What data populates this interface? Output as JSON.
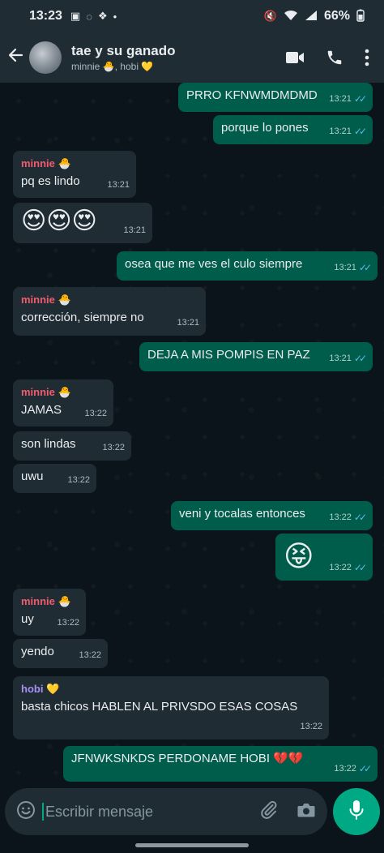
{
  "status_bar": {
    "time": "13:23",
    "battery": "66%"
  },
  "header": {
    "title": "tae y su ganado",
    "subtitle": "minnie 🐣, hobi 💛"
  },
  "messages": [
    {
      "dir": "out",
      "text": "PRRO KFNWMDMDMD",
      "time": "13:21"
    },
    {
      "dir": "out",
      "text": "porque lo pones",
      "time": "13:21"
    },
    {
      "dir": "in",
      "sender": "minnie 🐣",
      "text": "pq es lindo",
      "time": "13:21"
    },
    {
      "dir": "in",
      "text": "😍😍😍",
      "time": "13:21"
    },
    {
      "dir": "out",
      "text": "osea que me ves el culo siempre",
      "time": "13:21"
    },
    {
      "dir": "in",
      "sender": "minnie 🐣",
      "text": "corrección, siempre no",
      "time": "13:21"
    },
    {
      "dir": "out",
      "text": "DEJA A MIS POMPIS EN PAZ",
      "time": "13:21"
    },
    {
      "dir": "in",
      "sender": "minnie 🐣",
      "text": "JAMAS",
      "time": "13:22"
    },
    {
      "dir": "in",
      "text": "son lindas",
      "time": "13:22"
    },
    {
      "dir": "in",
      "text": "uwu",
      "time": "13:22"
    },
    {
      "dir": "out",
      "text": "veni y tocalas entonces",
      "time": "13:22"
    },
    {
      "dir": "out",
      "text": "😝",
      "time": "13:22"
    },
    {
      "dir": "in",
      "sender": "minnie 🐣",
      "text": "uy",
      "time": "13:22"
    },
    {
      "dir": "in",
      "text": "yendo",
      "time": "13:22"
    },
    {
      "dir": "in",
      "sender": "hobi 💛",
      "text": "basta chicos HABLEN AL PRIVSDO ESAS COSAS",
      "time": "13:22"
    },
    {
      "dir": "out",
      "text": "JFNWKSNKDS PERDONAME HOBI 💔💔",
      "time": "13:22"
    }
  ],
  "composer": {
    "placeholder": "Escribir mensaje"
  },
  "colors": {
    "sender_minnie": "#f15c6d",
    "sender_hobi": "#a791f3",
    "outgoing_bubble": "#005c4b",
    "incoming_bubble": "#1f2c33",
    "accent": "#00a884",
    "read_ticks": "#53bdeb"
  },
  "icons": {
    "header": [
      "arrow-back-icon",
      "video-call-icon",
      "phone-icon",
      "more-vert-icon"
    ],
    "composer": [
      "emoji-icon",
      "attach-icon",
      "camera-icon",
      "mic-icon"
    ]
  }
}
